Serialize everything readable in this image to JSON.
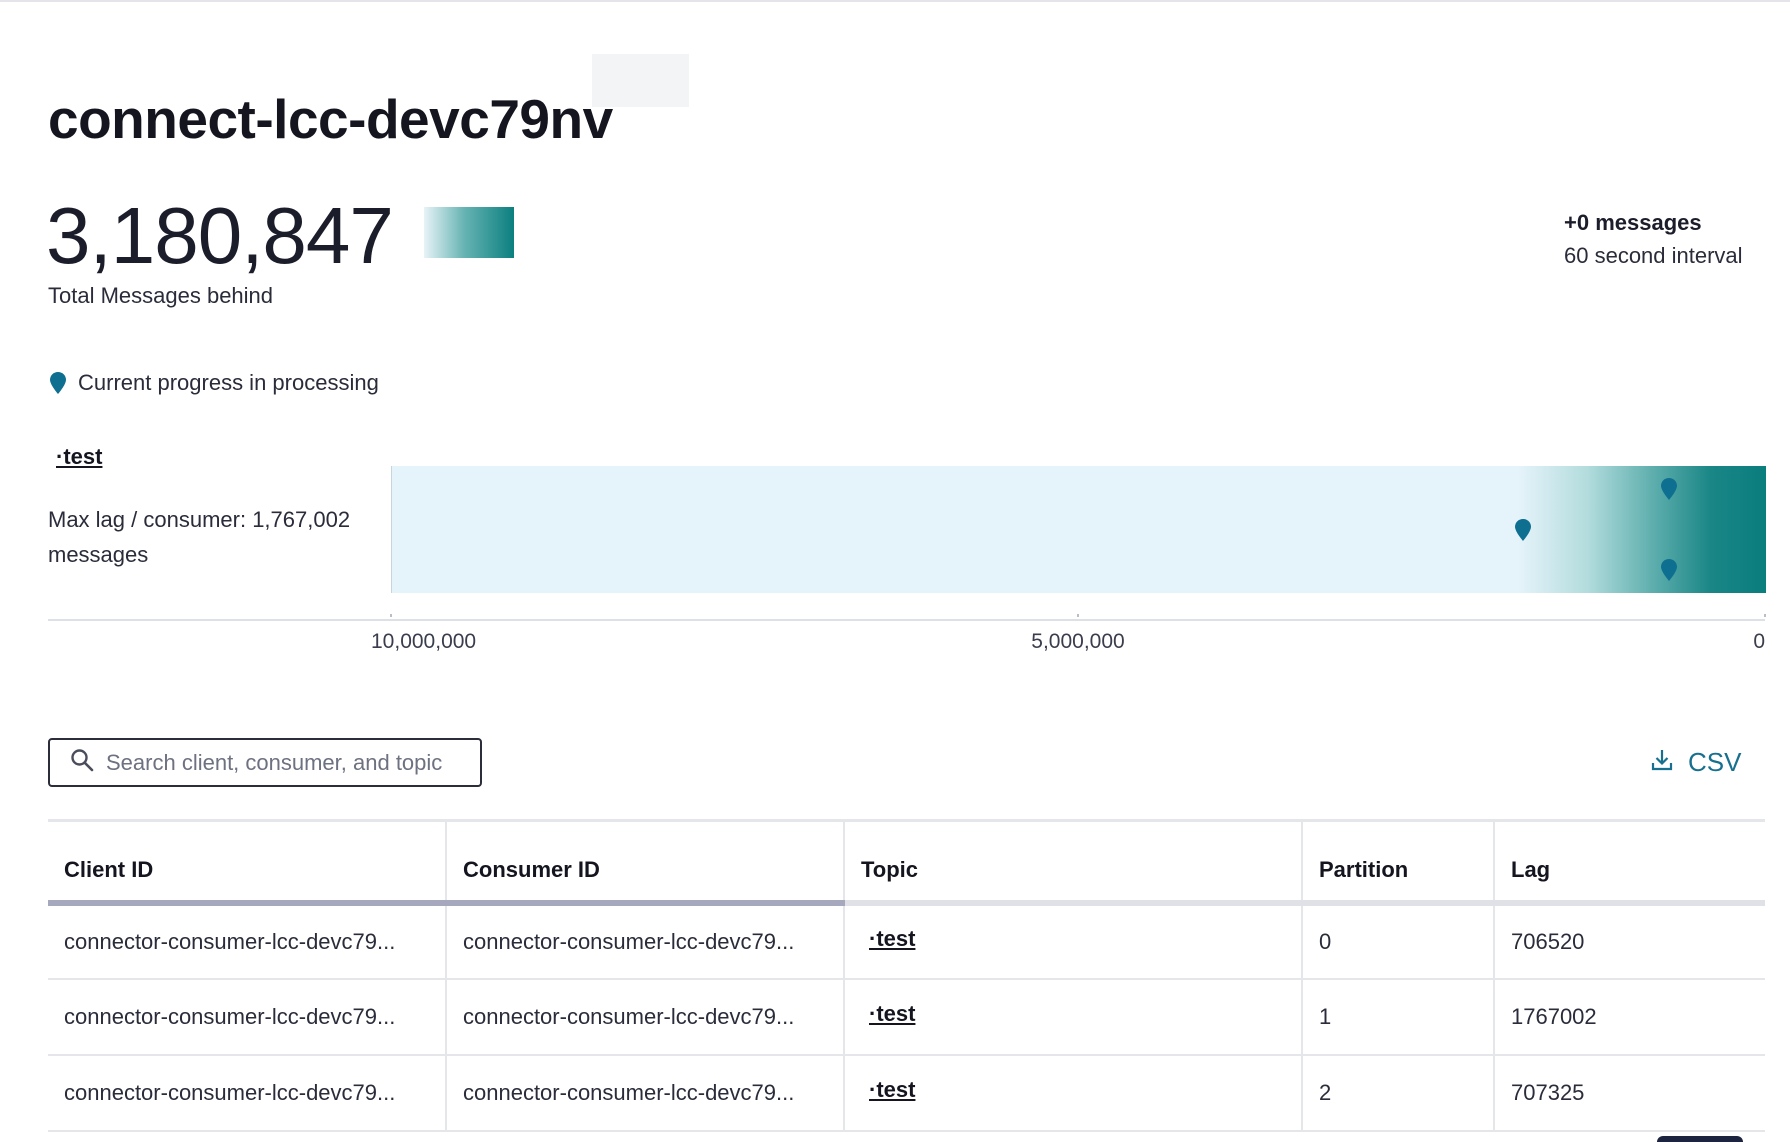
{
  "page": {
    "title": "connect-lcc-devc79nv"
  },
  "summary": {
    "total_behind": "3,180,847",
    "total_behind_label": "Total Messages behind",
    "delta_messages": "+0 messages",
    "delta_interval": "60 second interval",
    "trend_colors": [
      "#e7f3f7",
      "#0c7f7f"
    ]
  },
  "legend": {
    "label": "Current progress in processing",
    "icon": "map-pin-icon"
  },
  "topic_panel": {
    "topic_name": "·test",
    "max_lag_label": "Max lag / consumer: 1,767,002 messages"
  },
  "lag_chart": {
    "axis": {
      "labels": [
        "10,000,000",
        "5,000,000",
        "0"
      ],
      "ticks": [
        10000000,
        5000000,
        0
      ],
      "domain": [
        10000000,
        0
      ]
    },
    "partition_lags": [
      706520,
      1767002,
      707325
    ],
    "colors": {
      "bar": "#e5f3fa",
      "fill_end": "#0a7d7d",
      "pin": "#0e6f91"
    }
  },
  "search": {
    "placeholder": "Search client, consumer, and topic",
    "value": ""
  },
  "csv": {
    "label": "CSV",
    "icon": "download-icon"
  },
  "table": {
    "columns": [
      "Client ID",
      "Consumer ID",
      "Topic",
      "Partition",
      "Lag"
    ],
    "rows": [
      {
        "client_id": "connector-consumer-lcc-devc79...",
        "consumer_id": "connector-consumer-lcc-devc79...",
        "topic": "·test",
        "partition": "0",
        "lag": "706520"
      },
      {
        "client_id": "connector-consumer-lcc-devc79...",
        "consumer_id": "connector-consumer-lcc-devc79...",
        "topic": "·test",
        "partition": "1",
        "lag": "1767002"
      },
      {
        "client_id": "connector-consumer-lcc-devc79...",
        "consumer_id": "connector-consumer-lcc-devc79...",
        "topic": "·test",
        "partition": "2",
        "lag": "707325"
      }
    ]
  }
}
